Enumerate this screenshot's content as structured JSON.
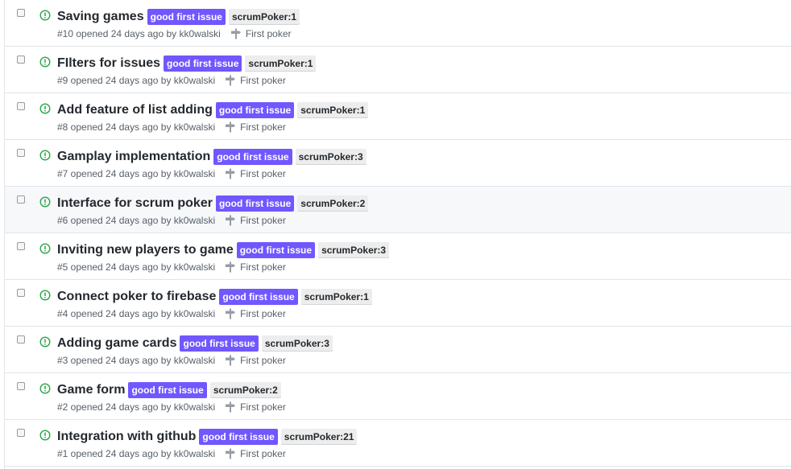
{
  "colors": {
    "open_icon": "#28a745",
    "good_first_issue": "#7057ff",
    "poker_label": "#ededed"
  },
  "icons": {
    "status": "issue-opened-icon",
    "milestone": "milestone-icon"
  },
  "issues": [
    {
      "title": "Saving games",
      "labels": [
        "good first issue",
        "scrumPoker:1"
      ],
      "meta": "#10 opened 24 days ago by kk0walski",
      "milestone": "First poker"
    },
    {
      "title": "FIlters for issues",
      "labels": [
        "good first issue",
        "scrumPoker:1"
      ],
      "meta": "#9 opened 24 days ago by kk0walski",
      "milestone": "First poker"
    },
    {
      "title": "Add feature of list adding",
      "labels": [
        "good first issue",
        "scrumPoker:1"
      ],
      "meta": "#8 opened 24 days ago by kk0walski",
      "milestone": "First poker"
    },
    {
      "title": "Gamplay implementation",
      "labels": [
        "good first issue",
        "scrumPoker:3"
      ],
      "meta": "#7 opened 24 days ago by kk0walski",
      "milestone": "First poker"
    },
    {
      "title": "Interface for scrum poker",
      "labels": [
        "good first issue",
        "scrumPoker:2"
      ],
      "meta": "#6 opened 24 days ago by kk0walski",
      "milestone": "First poker"
    },
    {
      "title": "Inviting new players to game",
      "labels": [
        "good first issue",
        "scrumPoker:3"
      ],
      "meta": "#5 opened 24 days ago by kk0walski",
      "milestone": "First poker"
    },
    {
      "title": "Connect poker to firebase",
      "labels": [
        "good first issue",
        "scrumPoker:1"
      ],
      "meta": "#4 opened 24 days ago by kk0walski",
      "milestone": "First poker"
    },
    {
      "title": "Adding game cards",
      "labels": [
        "good first issue",
        "scrumPoker:3"
      ],
      "meta": "#3 opened 24 days ago by kk0walski",
      "milestone": "First poker"
    },
    {
      "title": "Game form",
      "labels": [
        "good first issue",
        "scrumPoker:2"
      ],
      "meta": "#2 opened 24 days ago by kk0walski",
      "milestone": "First poker"
    },
    {
      "title": "Integration with github",
      "labels": [
        "good first issue",
        "scrumPoker:21"
      ],
      "meta": "#1 opened 24 days ago by kk0walski",
      "milestone": "First poker"
    }
  ]
}
